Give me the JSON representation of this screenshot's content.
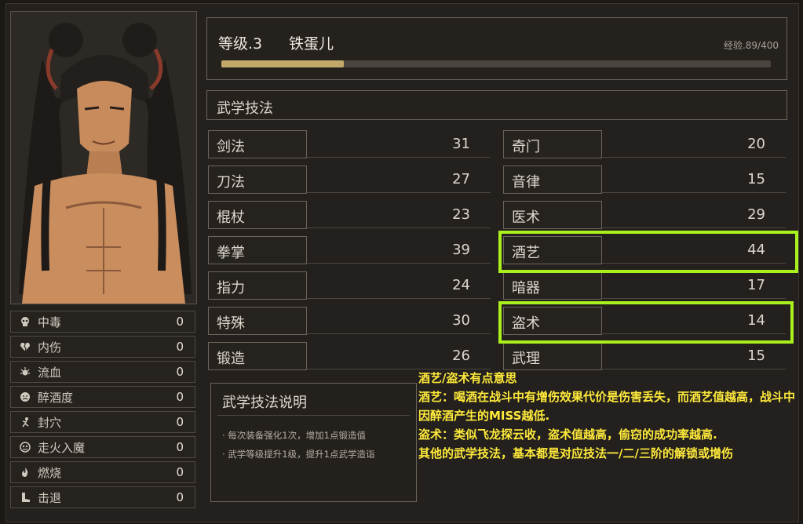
{
  "header": {
    "level_text": "等级.3",
    "character_name": "铁蛋儿",
    "exp_text": "经验.89/400",
    "exp_progress": 0.2225
  },
  "section_title": "武学技法",
  "skills_left": [
    {
      "label": "剑法",
      "value": "31"
    },
    {
      "label": "刀法",
      "value": "27"
    },
    {
      "label": "棍杖",
      "value": "23"
    },
    {
      "label": "拳掌",
      "value": "39"
    },
    {
      "label": "指力",
      "value": "24"
    },
    {
      "label": "特殊",
      "value": "30"
    },
    {
      "label": "锻造",
      "value": "26"
    }
  ],
  "skills_right": [
    {
      "label": "奇门",
      "value": "20"
    },
    {
      "label": "音律",
      "value": "15"
    },
    {
      "label": "医术",
      "value": "29"
    },
    {
      "label": "酒艺",
      "value": "44"
    },
    {
      "label": "暗器",
      "value": "17"
    },
    {
      "label": "盗术",
      "value": "14"
    },
    {
      "label": "武理",
      "value": "15"
    }
  ],
  "status_effects": [
    {
      "icon": "skull-icon",
      "label": "中毒",
      "value": "0"
    },
    {
      "icon": "broken-heart-icon",
      "label": "内伤",
      "value": "0"
    },
    {
      "icon": "blood-drop-icon",
      "label": "流血",
      "value": "0"
    },
    {
      "icon": "drunk-face-icon",
      "label": "醉酒度",
      "value": "0"
    },
    {
      "icon": "acupoint-icon",
      "label": "封穴",
      "value": "0"
    },
    {
      "icon": "demon-face-icon",
      "label": "走火入魔",
      "value": "0"
    },
    {
      "icon": "flame-icon",
      "label": "燃烧",
      "value": "0"
    },
    {
      "icon": "boot-icon",
      "label": "击退",
      "value": "0"
    }
  ],
  "description": {
    "title": "武学技法说明",
    "lines": [
      "· 每次装备强化1次，增加1点锻造值",
      "· 武学等级提升1级，提升1点武学造诣"
    ]
  },
  "overlay_text": {
    "line1": "酒艺/盗术有点意思",
    "line2": "酒艺：喝酒在战斗中有增伤效果代价是伤害丢失，而酒艺值越高，战斗中因醉酒产生的MISS越低.",
    "line3": "盗术：类似飞龙探云收，盗术值越高，偷窃的成功率越高.",
    "line4": "其他的武学技法，基本都是对应技法一/二/三阶的解锁或增伤"
  },
  "colors": {
    "highlight": "#aaf01c",
    "overlay_text": "#ffea3b",
    "exp_fill": "#c2a969"
  }
}
